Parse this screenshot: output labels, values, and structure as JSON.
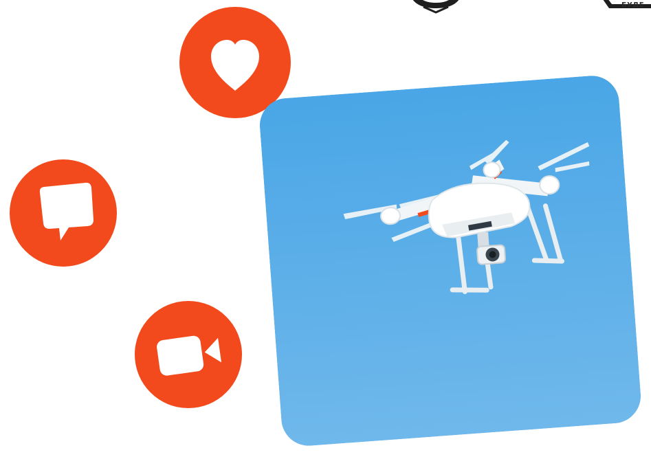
{
  "colors": {
    "accent": "#f24a1d",
    "icon_fill": "#ffffff",
    "sky_top": "#4aa6e6",
    "sky_bottom": "#6fb8eb",
    "ink": "#1f1f1f"
  },
  "icons": {
    "heart": "heart-icon",
    "comment": "comment-icon",
    "video": "video-camera-icon"
  },
  "photo": {
    "subject": "drone-illustration"
  },
  "branding": {
    "cropped_logo_text": "БУДЕ"
  }
}
